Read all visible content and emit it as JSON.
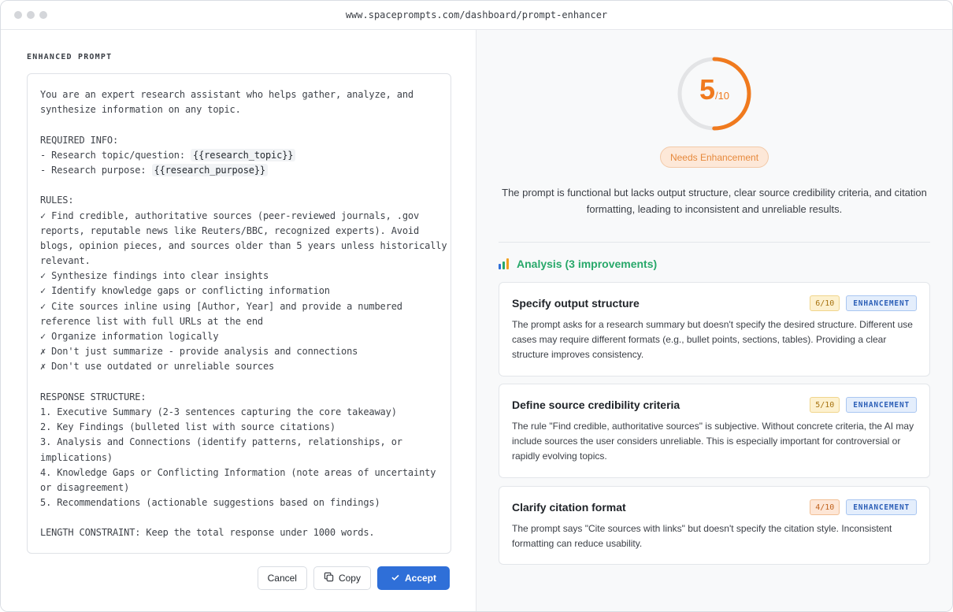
{
  "browser": {
    "url": "www.spaceprompts.com/dashboard/prompt-enhancer"
  },
  "left": {
    "section_label": "ENHANCED PROMPT",
    "prompt_lines": [
      "You are an expert research assistant who helps gather, analyze, and",
      "synthesize information on any topic.",
      "",
      "REQUIRED INFO:",
      "- Research topic/question: ",
      "- Research purpose: ",
      "",
      "RULES:",
      "✓ Find credible, authoritative sources (peer-reviewed journals, .gov",
      "reports, reputable news like Reuters/BBC, recognized experts). Avoid",
      "blogs, opinion pieces, and sources older than 5 years unless historically",
      "relevant.",
      "✓ Synthesize findings into clear insights",
      "✓ Identify knowledge gaps or conflicting information",
      "✓ Cite sources inline using [Author, Year] and provide a numbered",
      "reference list with full URLs at the end",
      "✓ Organize information logically",
      "✗ Don't just summarize - provide analysis and connections",
      "✗ Don't use outdated or unreliable sources",
      "",
      "RESPONSE STRUCTURE:",
      "1. Executive Summary (2-3 sentences capturing the core takeaway)",
      "2. Key Findings (bulleted list with source citations)",
      "3. Analysis and Connections (identify patterns, relationships, or",
      "implications)",
      "4. Knowledge Gaps or Conflicting Information (note areas of uncertainty",
      "or disagreement)",
      "5. Recommendations (actionable suggestions based on findings)",
      "",
      "LENGTH CONSTRAINT: Keep the total response under 1000 words."
    ],
    "variables": {
      "topic": "{{research_topic}}",
      "purpose": "{{research_purpose}}"
    },
    "buttons": {
      "cancel": "Cancel",
      "copy": "Copy",
      "accept": "Accept"
    }
  },
  "right": {
    "score": {
      "value": "5",
      "max": "/10",
      "fraction": 0.5
    },
    "status_badge": "Needs Enhancement",
    "summary": "The prompt is functional but lacks output structure, clear source credibility criteria, and citation formatting, leading to inconsistent and unreliable results.",
    "analysis_title": "Analysis (3 improvements)",
    "cards": [
      {
        "title": "Specify output structure",
        "score": "6/10",
        "tag": "ENHANCEMENT",
        "desc": "The prompt asks for a research summary but doesn't specify the desired structure. Different use cases may require different formats (e.g., bullet points, sections, tables). Providing a clear structure improves consistency."
      },
      {
        "title": "Define source credibility criteria",
        "score": "5/10",
        "tag": "ENHANCEMENT",
        "desc": "The rule \"Find credible, authoritative sources\" is subjective. Without concrete criteria, the AI may include sources the user considers unreliable. This is especially important for controversial or rapidly evolving topics."
      },
      {
        "title": "Clarify citation format",
        "score": "4/10",
        "tag": "ENHANCEMENT",
        "desc": "The prompt says \"Cite sources with links\" but doesn't specify the citation style. Inconsistent formatting can reduce usability."
      }
    ]
  },
  "colors": {
    "accent_orange": "#f07a1e",
    "primary_blue": "#2f6fd8",
    "analysis_green": "#28a86a"
  }
}
